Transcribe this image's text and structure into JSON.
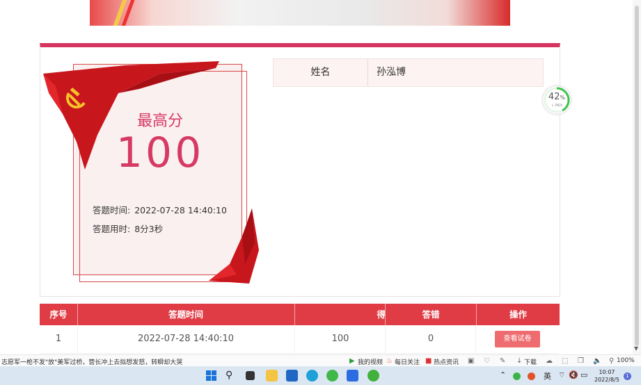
{
  "certificate": {
    "best_label": "最高分",
    "best_score": "100",
    "time_label": "答题时间:",
    "time_value": "2022-07-28 14:40:10",
    "duration_label": "答题用时:",
    "duration_value": "8分3秒"
  },
  "info": {
    "name_key": "姓名",
    "name_value": "孙泓博"
  },
  "speed_widget": {
    "percent": "42",
    "percent_unit": "%",
    "rate": "↓ 0K/s",
    "fraction": 0.42
  },
  "results": {
    "headers": [
      "序号",
      "答题时间",
      "得分",
      "答错",
      "操作"
    ],
    "rows": [
      {
        "index": "1",
        "time": "2022-07-28 14:40:10",
        "score": "100",
        "wrong": "0",
        "action": "查看试卷"
      }
    ]
  },
  "statusbar": {
    "news": "志愿军一枪不发\"放\"美军过桥，营长冲上去拟想发怒，转瞬却大哭",
    "my_video": "我的视频",
    "daily": "每日关注",
    "hot": "热点资讯",
    "download": "下载",
    "zoom": "100%"
  },
  "taskbar": {
    "ime": "英",
    "time": "10:07",
    "date": "2022/8/5",
    "notifications": "1"
  },
  "colors": {
    "accent": "#d6335f",
    "header_red": "#e03c45",
    "button": "#ee6c6f"
  }
}
